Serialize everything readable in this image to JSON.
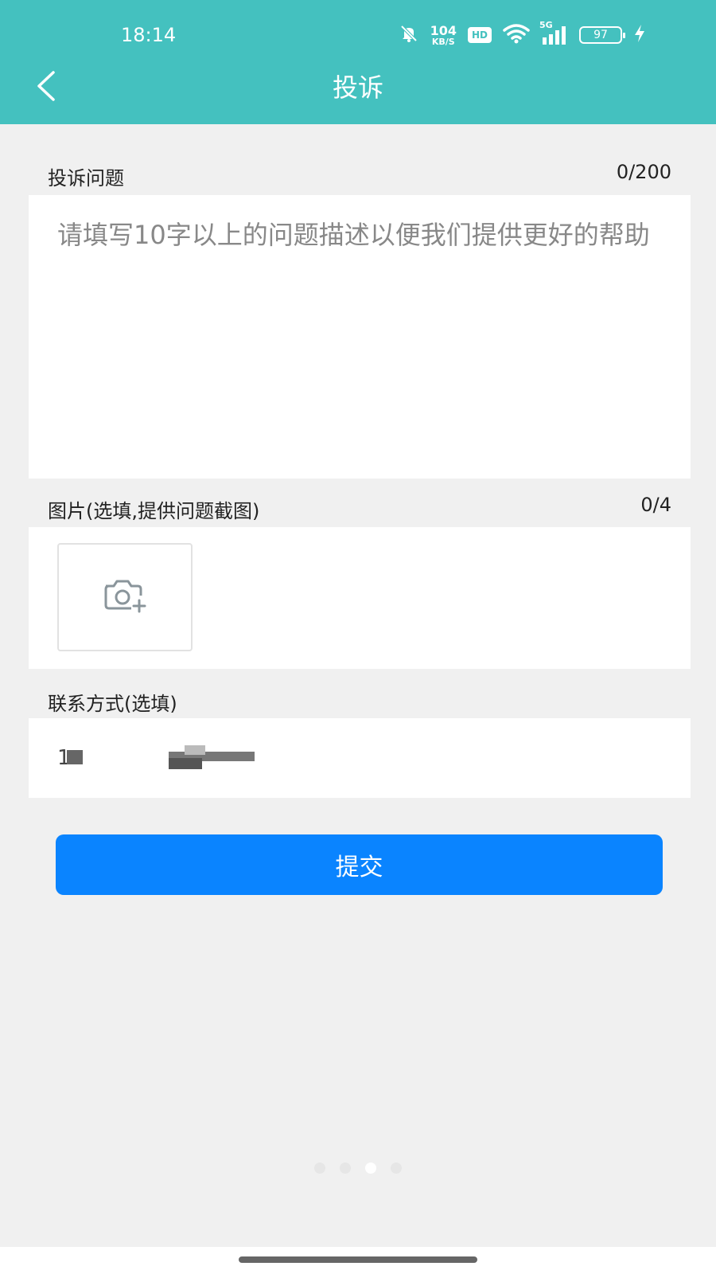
{
  "status_bar": {
    "time": "18:14",
    "net_speed_value": "104",
    "net_speed_unit": "KB/S",
    "hd_label": "HD",
    "network_type": "5G",
    "battery_level": "97",
    "icons": [
      "mute-bell-icon",
      "wifi-icon",
      "signal-icon",
      "battery-icon",
      "charging-icon"
    ]
  },
  "header": {
    "title": "投诉",
    "back_icon": "chevron-left-icon",
    "bg_color": "#44c1bf"
  },
  "complaint": {
    "label": "投诉问题",
    "counter": "0/200",
    "placeholder": "请填写10字以上的问题描述以便我们提供更好的帮助",
    "value": ""
  },
  "images": {
    "label": "图片(选填,提供问题截图)",
    "counter": "0/4",
    "add_icon": "camera-add-icon"
  },
  "contact": {
    "label": "联系方式(选填)",
    "value": "1",
    "note": "redacted-value"
  },
  "submit": {
    "label": "提交",
    "color": "#0a84ff"
  },
  "pager": {
    "total": 4,
    "active_index": 2
  }
}
